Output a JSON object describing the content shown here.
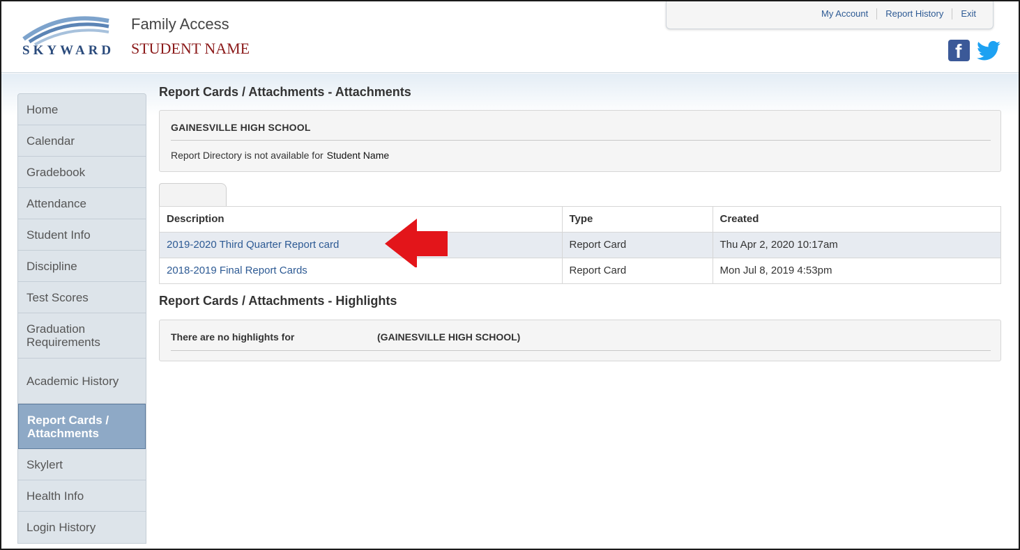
{
  "header": {
    "app_title": "Family Access",
    "student_name": "STUDENT NAME",
    "logo_text": "SKYWARD",
    "top_links": [
      "My Account",
      "Report History",
      "Exit"
    ],
    "social": [
      "facebook-icon",
      "twitter-icon"
    ]
  },
  "sidebar": {
    "items": [
      {
        "label": "Home"
      },
      {
        "label": "Calendar"
      },
      {
        "label": "Gradebook"
      },
      {
        "label": "Attendance"
      },
      {
        "label": "Student Info"
      },
      {
        "label": "Discipline"
      },
      {
        "label": "Test Scores"
      },
      {
        "label": "Graduation Requirements"
      },
      {
        "label": "Academic History"
      },
      {
        "label": "Report Cards / Attachments",
        "active": true
      },
      {
        "label": "Skylert"
      },
      {
        "label": "Health Info"
      },
      {
        "label": "Login History"
      }
    ]
  },
  "main": {
    "attachments_title": "Report Cards / Attachments - Attachments",
    "school_name": "GAINESVILLE HIGH SCHOOL",
    "directory_message": "Report Directory is not available for",
    "directory_student": "Student Name",
    "table": {
      "headers": [
        "Description",
        "Type",
        "Created"
      ],
      "rows": [
        {
          "description": "2019-2020 Third Quarter Report card",
          "type": "Report Card",
          "created": "Thu Apr 2, 2020 10:17am"
        },
        {
          "description": "2018-2019 Final Report Cards",
          "type": "Report Card",
          "created": "Mon Jul 8, 2019 4:53pm"
        }
      ]
    },
    "highlights_title": "Report Cards / Attachments - Highlights",
    "highlights_message": "There are no highlights for",
    "highlights_school": "(GAINESVILLE HIGH SCHOOL)"
  },
  "colors": {
    "link": "#2d5a94",
    "student_name": "#8b1a1a",
    "active_nav": "#8ea9c6",
    "arrow": "#e3151a"
  }
}
